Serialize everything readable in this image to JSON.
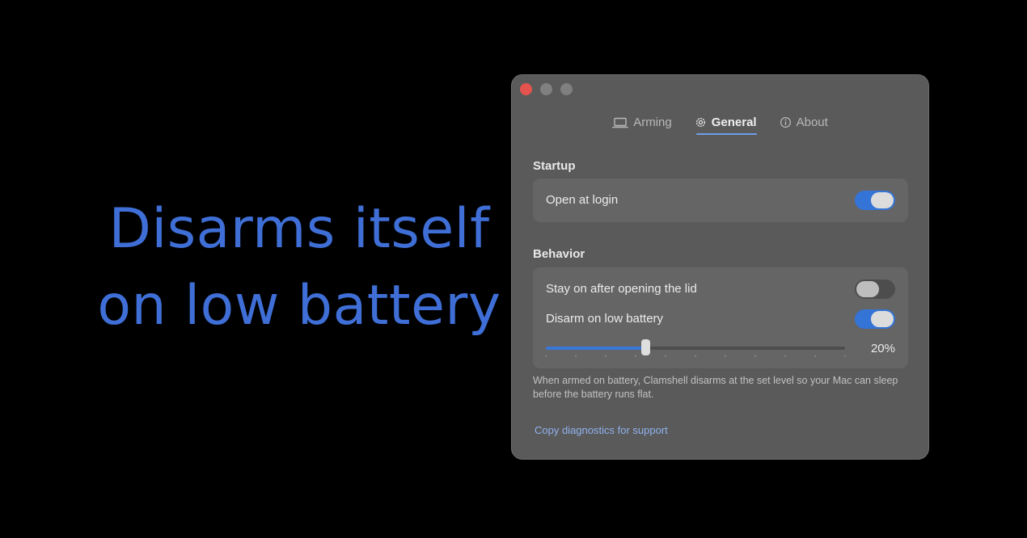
{
  "headline": {
    "line1": "Disarms itself",
    "line2": "on low battery"
  },
  "tabs": [
    {
      "label": "Arming",
      "icon": "laptop-icon",
      "active": false
    },
    {
      "label": "General",
      "icon": "gear-icon",
      "active": true
    },
    {
      "label": "About",
      "icon": "info-icon",
      "active": false
    }
  ],
  "startup": {
    "title": "Startup",
    "open_at_login": {
      "label": "Open at login",
      "enabled": true
    }
  },
  "behavior": {
    "title": "Behavior",
    "stay_on": {
      "label": "Stay on after opening the lid",
      "enabled": false
    },
    "disarm_low_battery": {
      "label": "Disarm on low battery",
      "enabled": true
    },
    "threshold": {
      "value": 0.3333,
      "display": "20%",
      "steps": 10
    }
  },
  "help_text": "When armed on battery, Clamshell disarms at the set level so your Mac can sleep before the battery runs flat.",
  "diagnostics_link": "Copy diagnostics for support",
  "colors": {
    "accent": "#3474d6",
    "headline": "#3f6fd6",
    "window_bg": "#5a5a5a"
  }
}
